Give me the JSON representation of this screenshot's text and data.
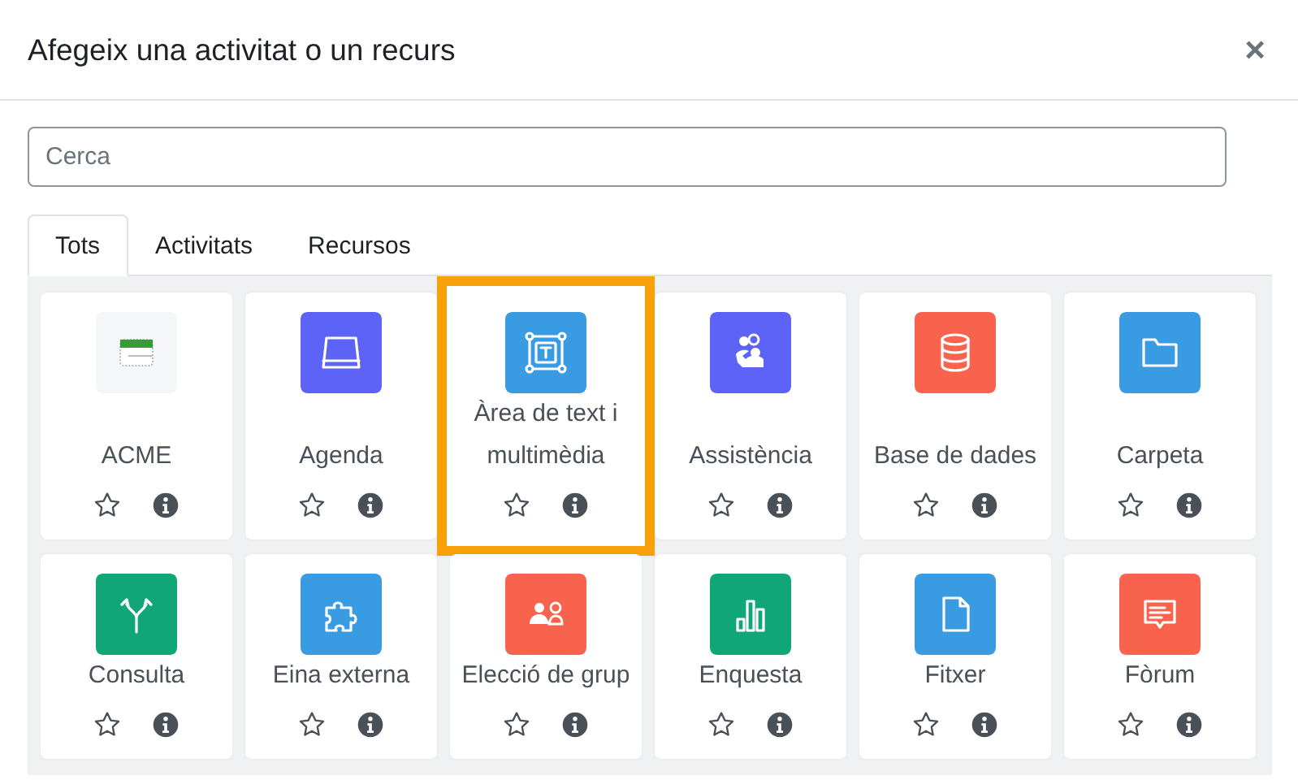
{
  "dialog": {
    "title": "Afegeix una activitat o un recurs",
    "close": "×"
  },
  "search": {
    "placeholder": "Cerca"
  },
  "tabs": [
    {
      "label": "Tots",
      "selected": true
    },
    {
      "label": "Activitats",
      "selected": false
    },
    {
      "label": "Recursos",
      "selected": false
    }
  ],
  "items": [
    {
      "label": "ACME",
      "color": "#f5f6f7",
      "highlighted": false,
      "starred": false
    },
    {
      "label": "Agenda",
      "color": "#5d63f6",
      "highlighted": false,
      "starred": false
    },
    {
      "label": "Àrea de text i multimèdia",
      "color": "#399be2",
      "highlighted": true,
      "starred": false
    },
    {
      "label": "Assistència",
      "color": "#5d63f6",
      "highlighted": false,
      "starred": false
    },
    {
      "label": "Base de dades",
      "color": "#f7634d",
      "highlighted": false,
      "starred": false
    },
    {
      "label": "Carpeta",
      "color": "#399be2",
      "highlighted": false,
      "starred": false
    },
    {
      "label": "Consulta",
      "color": "#11a676",
      "highlighted": false,
      "starred": false
    },
    {
      "label": "Eina externa",
      "color": "#399be2",
      "highlighted": false,
      "starred": false
    },
    {
      "label": "Elecció de grup",
      "color": "#f7634d",
      "highlighted": false,
      "starred": false
    },
    {
      "label": "Enquesta",
      "color": "#11a676",
      "highlighted": false,
      "starred": false
    },
    {
      "label": "Fitxer",
      "color": "#399be2",
      "highlighted": false,
      "starred": false
    },
    {
      "label": "Fòrum",
      "color": "#f7634d",
      "highlighted": false,
      "starred": false
    }
  ]
}
